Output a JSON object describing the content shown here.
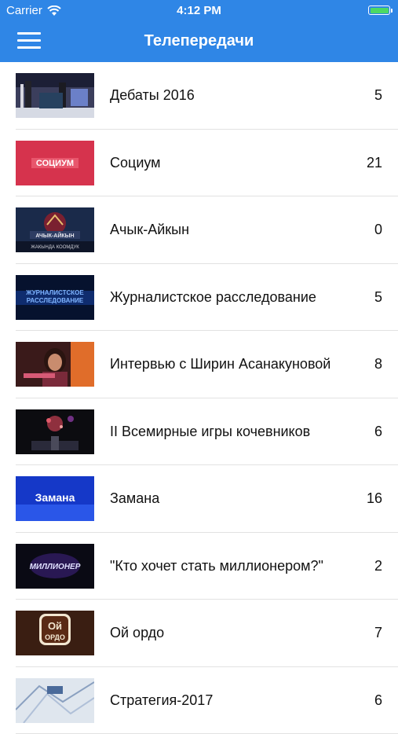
{
  "status_bar": {
    "carrier": "Carrier",
    "time": "4:12 PM",
    "battery_color": "#4cd964"
  },
  "nav": {
    "title": "Телепередачи",
    "menu_icon": "hamburger-menu-icon",
    "color": "#2f86e6"
  },
  "items": [
    {
      "title": "Дебаты 2016",
      "count": "5"
    },
    {
      "title": "Социум",
      "count": "21",
      "thumb_text": "СОЦИУМ"
    },
    {
      "title": "Ачык-Айкын",
      "count": "0",
      "thumb_text": "АЧЫК-АЙКЫН",
      "thumb_subtext": "ЖАКЫНДА КООМДУК"
    },
    {
      "title": "Журналистское расследование",
      "count": "5",
      "thumb_text": "ЖУРНАЛИСТСКОЕ",
      "thumb_subtext": "РАССЛЕДОВАНИЕ"
    },
    {
      "title": "Интервью с Ширин Асанакуновой",
      "count": "8"
    },
    {
      "title": "II Всемирные игры кочевников",
      "count": "6"
    },
    {
      "title": "Замана",
      "count": "16",
      "thumb_text": "Замана"
    },
    {
      "title": "\"Кто хочет стать миллионером?\"",
      "count": "2",
      "thumb_text": "МИЛЛИОНЕР"
    },
    {
      "title": "Ой ордо",
      "count": "7",
      "thumb_text": "Ой",
      "thumb_subtext": "ОРДО"
    },
    {
      "title": "Стратегия-2017",
      "count": "6"
    }
  ]
}
